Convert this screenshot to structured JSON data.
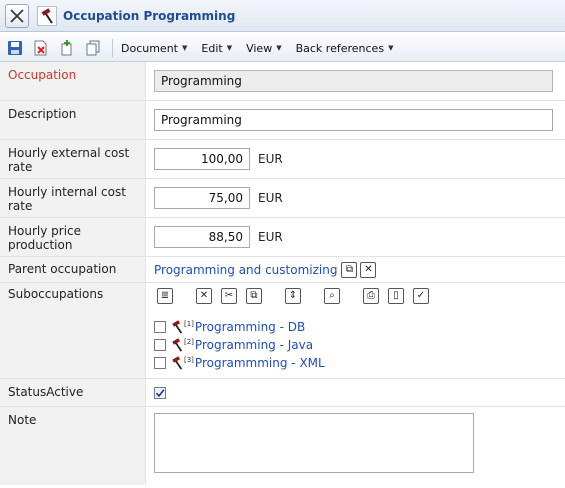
{
  "window": {
    "title": "Occupation Programming"
  },
  "toolbar": {
    "menus": [
      "Document",
      "Edit",
      "View",
      "Back references"
    ]
  },
  "form": {
    "occupation": {
      "label": "Occupation",
      "value": "Programming"
    },
    "description": {
      "label": "Description",
      "value": "Programming"
    },
    "ext_rate": {
      "label": "Hourly external cost rate",
      "value": "100,00",
      "unit": "EUR"
    },
    "int_rate": {
      "label": "Hourly internal cost rate",
      "value": "75,00",
      "unit": "EUR"
    },
    "price_prod": {
      "label": "Hourly price production",
      "value": "88,50",
      "unit": "EUR"
    },
    "parent": {
      "label": "Parent occupation",
      "value": "Programming and customizing"
    },
    "subocc": {
      "label": "Suboccupations",
      "items": [
        {
          "index": "[1]",
          "name": "Programming - DB"
        },
        {
          "index": "[2]",
          "name": "Programming - Java"
        },
        {
          "index": "[3]",
          "name": "Programmming - XML"
        }
      ]
    },
    "status": {
      "label": "StatusActive",
      "checked": true
    },
    "note": {
      "label": "Note",
      "value": ""
    }
  },
  "colors": {
    "link": "#1f4fb4",
    "title": "#1f4d93",
    "required_label": "#c8372d"
  }
}
